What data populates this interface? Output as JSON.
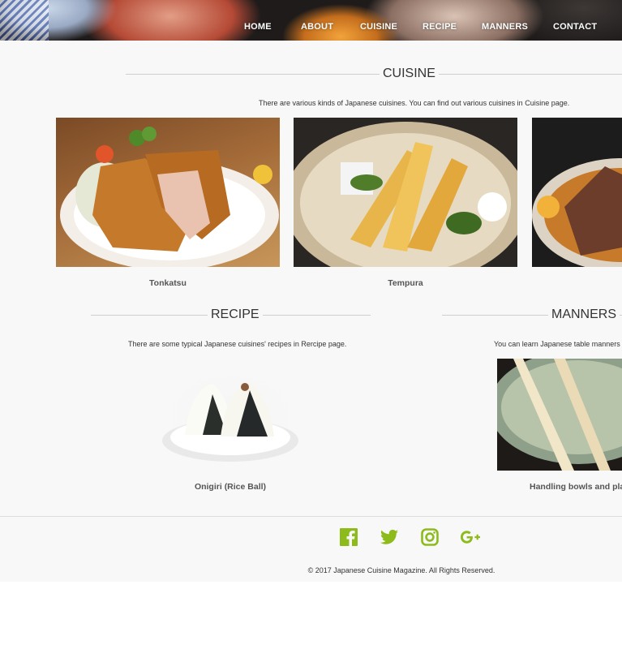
{
  "nav": {
    "items": [
      "HOME",
      "ABOUT",
      "CUISINE",
      "RECIPE",
      "MANNERS",
      "CONTACT"
    ]
  },
  "cuisine": {
    "title": "CUISINE",
    "description": "There are various kinds of Japanese cuisines. You can find out various cuisines in Cuisine page.",
    "items": [
      {
        "caption": "Tonkatsu"
      },
      {
        "caption": "Tempura"
      }
    ]
  },
  "recipe": {
    "title": "RECIPE",
    "description": "There are some typical Japanese cuisines' recipes in Rercipe page.",
    "caption": "Onigiri (Rice Ball)"
  },
  "manners": {
    "title": "MANNERS",
    "description": "You can learn Japanese table manners in",
    "caption": "Handling bowls and plat"
  },
  "footer": {
    "social_icons": [
      "facebook-icon",
      "twitter-icon",
      "instagram-icon",
      "google-plus-icon"
    ],
    "icon_color": "#8cbb1b",
    "copyright": "© 2017 Japanese Cuisine Magazine. All Rights Reserved."
  }
}
